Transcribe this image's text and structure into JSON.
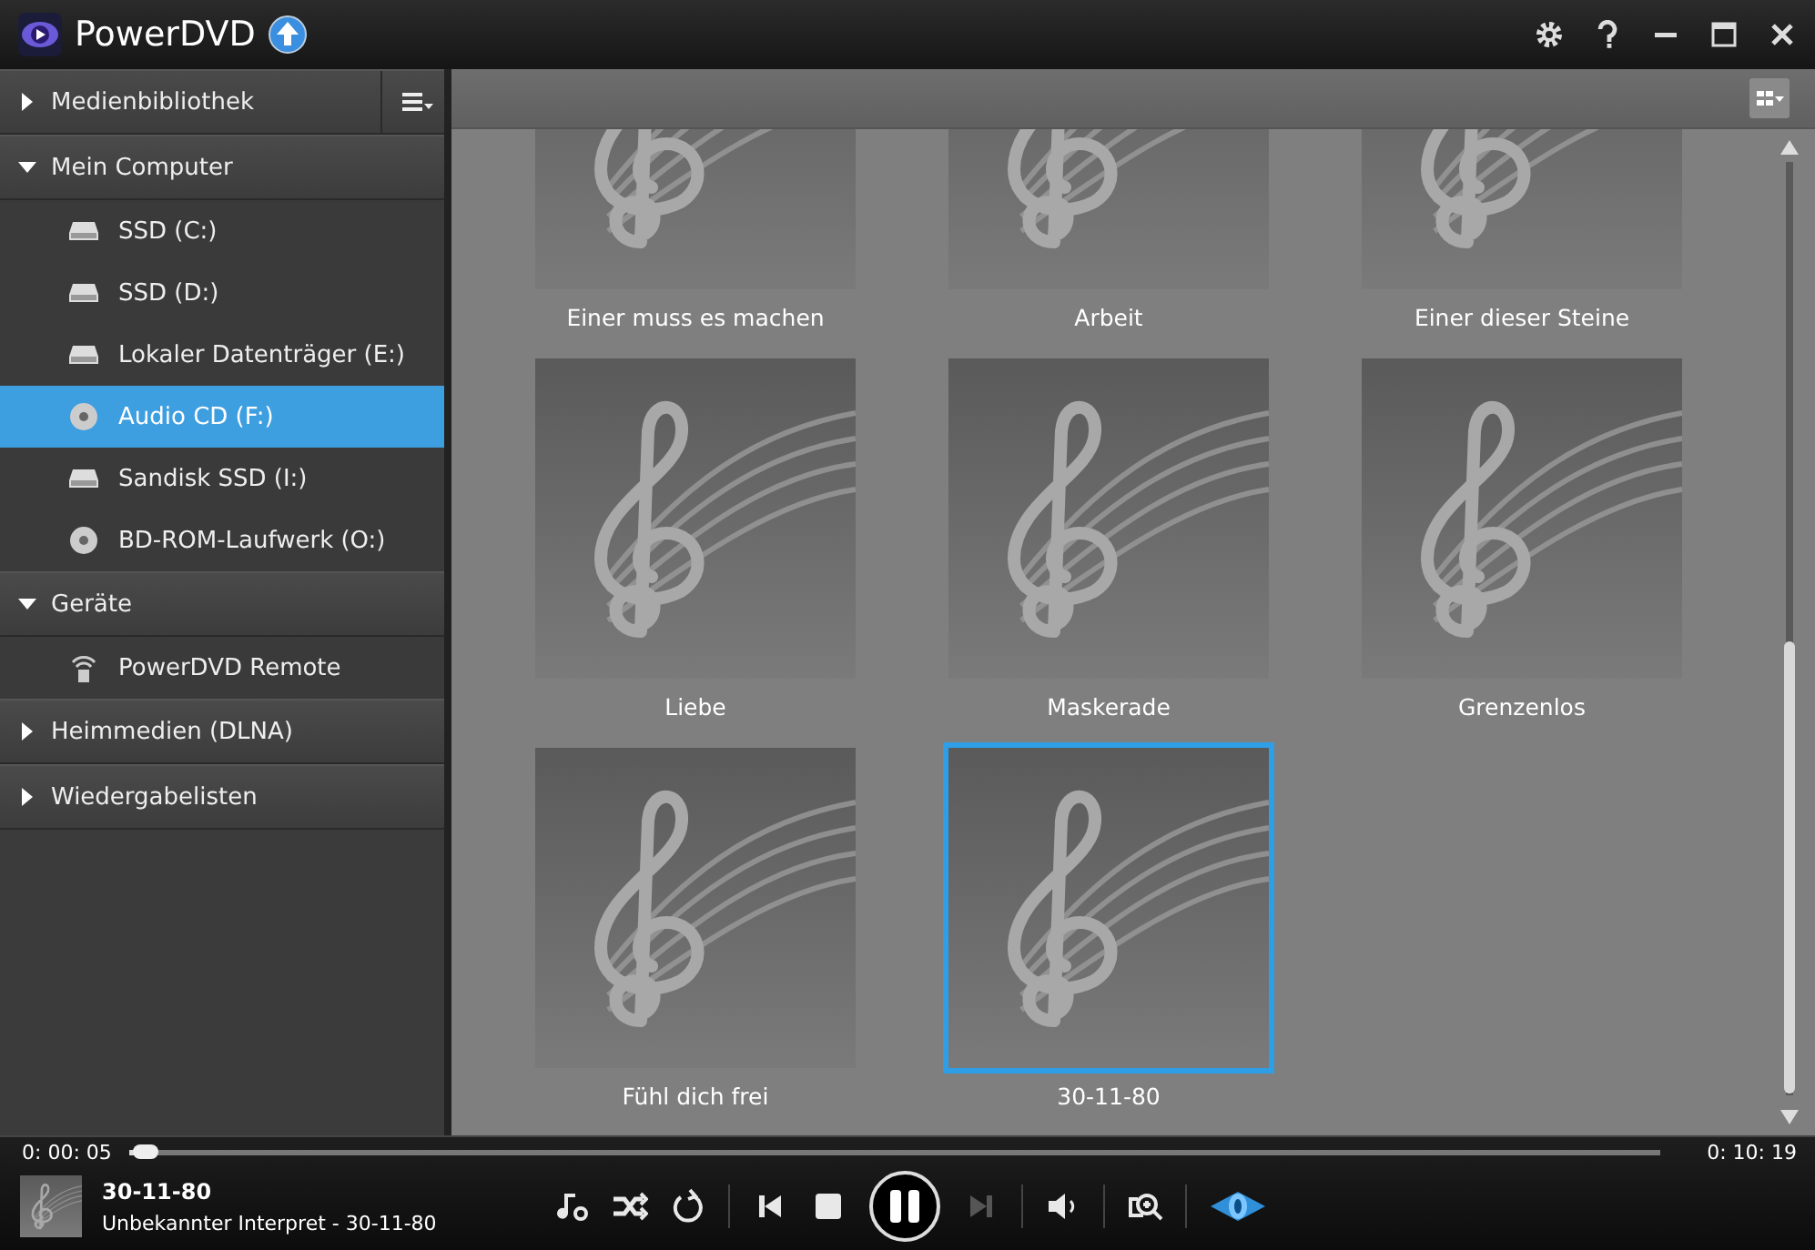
{
  "window": {
    "title": "PowerDVD"
  },
  "sidebar": {
    "sections": [
      {
        "label": "Medienbibliothek",
        "expanded": false
      },
      {
        "label": "Mein Computer",
        "expanded": true,
        "items": [
          {
            "label": "SSD (C:)",
            "kind": "drive",
            "selected": false
          },
          {
            "label": "SSD (D:)",
            "kind": "drive",
            "selected": false
          },
          {
            "label": "Lokaler Datenträger (E:)",
            "kind": "drive",
            "selected": false
          },
          {
            "label": "Audio CD (F:)",
            "kind": "disc",
            "selected": true
          },
          {
            "label": "Sandisk SSD (I:)",
            "kind": "drive",
            "selected": false
          },
          {
            "label": "BD-ROM-Laufwerk (O:)",
            "kind": "disc",
            "selected": false
          }
        ]
      },
      {
        "label": "Geräte",
        "expanded": true,
        "items": [
          {
            "label": "PowerDVD Remote",
            "kind": "remote",
            "selected": false
          }
        ]
      },
      {
        "label": "Heimmedien (DLNA)",
        "expanded": false
      },
      {
        "label": "Wiedergabelisten",
        "expanded": false
      }
    ]
  },
  "albums": [
    {
      "title": "Einer muss es machen",
      "selected": false
    },
    {
      "title": "Arbeit",
      "selected": false
    },
    {
      "title": "Einer dieser Steine",
      "selected": false
    },
    {
      "title": "Liebe",
      "selected": false
    },
    {
      "title": "Maskerade",
      "selected": false
    },
    {
      "title": "Grenzenlos",
      "selected": false
    },
    {
      "title": "Fühl dich frei",
      "selected": false
    },
    {
      "title": "30-11-80",
      "selected": true
    }
  ],
  "player": {
    "elapsed": "0: 00: 05",
    "duration": "0: 10: 19",
    "level": 0.005,
    "track_title": "30-11-80",
    "track_info": "Unbekannter Interpret - 30-11-80"
  }
}
